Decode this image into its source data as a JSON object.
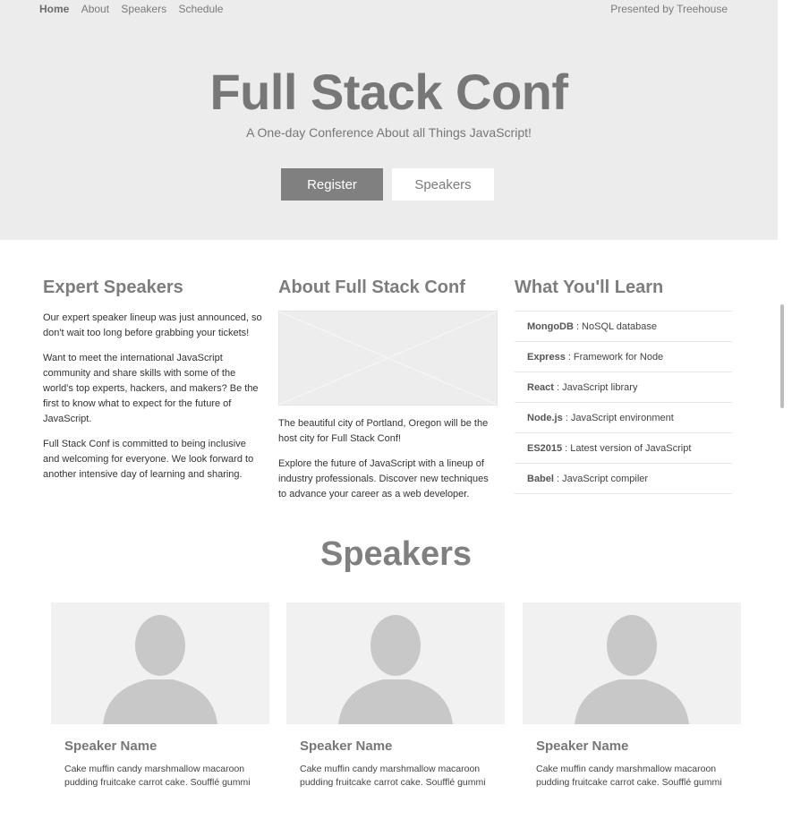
{
  "nav": {
    "items": [
      {
        "label": "Home"
      },
      {
        "label": "About"
      },
      {
        "label": "Speakers"
      },
      {
        "label": "Schedule"
      }
    ],
    "presented_by": "Presented by Treehouse"
  },
  "hero": {
    "title": "Full Stack Conf",
    "subtitle": "A One-day Conference About all Things JavaScript!",
    "register_label": "Register",
    "speakers_label": "Speakers"
  },
  "expert": {
    "heading": "Expert Speakers",
    "paragraphs": [
      "Our expert speaker lineup was just announced, so don't wait too long before grabbing your tickets!",
      "Want to meet the international JavaScript community and share skills with some of the world's top experts, hackers, and makers? Be the first to know what to expect for the future of JavaScript.",
      "Full Stack Conf is committed to being inclusive and welcoming for everyone. We look forward to another intensive day of learning and sharing."
    ]
  },
  "about": {
    "heading": "About Full Stack Conf",
    "paragraphs": [
      "The beautiful city of Portland, Oregon will be the host city for Full Stack Conf!",
      "Explore the future of JavaScript with a lineup of industry professionals. Discover new techniques to advance your career as a web developer."
    ]
  },
  "learn": {
    "heading": "What You'll Learn",
    "items": [
      {
        "term": "MongoDB",
        "desc": ": NoSQL database"
      },
      {
        "term": "Express",
        "desc": ": Framework for Node"
      },
      {
        "term": "React",
        "desc": ": JavaScript library"
      },
      {
        "term": "Node.js",
        "desc": ": JavaScript environment"
      },
      {
        "term": "ES2015",
        "desc": ": Latest version of JavaScript"
      },
      {
        "term": "Babel",
        "desc": ": JavaScript compiler"
      }
    ]
  },
  "speakers": {
    "heading": "Speakers",
    "cards": [
      {
        "name": "Speaker Name",
        "bio": "Cake muffin candy marshmallow macaroon pudding fruitcake carrot cake. Soufflé gummi"
      },
      {
        "name": "Speaker Name",
        "bio": "Cake muffin candy marshmallow macaroon pudding fruitcake carrot cake. Soufflé gummi"
      },
      {
        "name": "Speaker Name",
        "bio": "Cake muffin candy marshmallow macaroon pudding fruitcake carrot cake. Soufflé gummi"
      }
    ]
  }
}
